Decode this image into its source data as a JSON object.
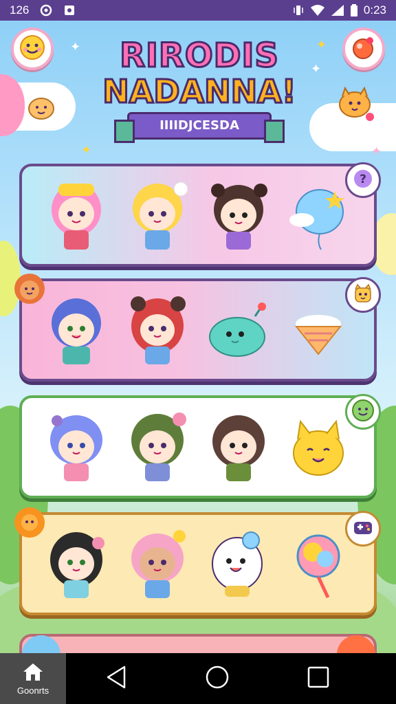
{
  "status_bar": {
    "time_left": "126",
    "time_right": "0:23",
    "icons": [
      "circle-notification-icon",
      "square-notification-icon",
      "vibrate-icon",
      "wifi-icon",
      "signal-icon",
      "battery-icon"
    ]
  },
  "header": {
    "logo_line1": "RIRODIS",
    "logo_line2": "NADANNA!",
    "logo_ribbon": "IIIIDJCESDA",
    "left_button_icon": "smiley-face-icon",
    "right_button_icon": "red-ball-icon"
  },
  "cards": [
    {
      "characters": [
        "pink-hair-girl-character",
        "blonde-girl-character",
        "brown-hair-girl-character",
        "blue-balloon-item"
      ],
      "badge_icon": "question-mark-icon"
    },
    {
      "characters": [
        "blue-hair-boy-character",
        "red-hair-girl-character",
        "teal-whale-character",
        "ice-cream-item"
      ],
      "badge_icon": "cat-face-icon"
    },
    {
      "characters": [
        "blue-hair-girl-character",
        "green-hair-girl-character",
        "brown-hair-boy-character",
        "yellow-cat-creature"
      ],
      "badge_icon": "green-smiley-icon"
    },
    {
      "characters": [
        "black-hair-girl-character",
        "pink-hair-girl-character",
        "white-ghost-character",
        "cotton-candy-item"
      ],
      "badge_icon": "game-controller-icon"
    }
  ],
  "nav": {
    "home_label": "Goonrts",
    "back_icon": "back-triangle-icon",
    "home_circle_icon": "home-circle-icon",
    "recents_icon": "recents-square-icon"
  },
  "colors": {
    "status_bar": "#5b3f8f",
    "card_border": "#6a4a8c",
    "accent_pink": "#ff6fb5",
    "accent_yellow": "#ffcf33"
  }
}
